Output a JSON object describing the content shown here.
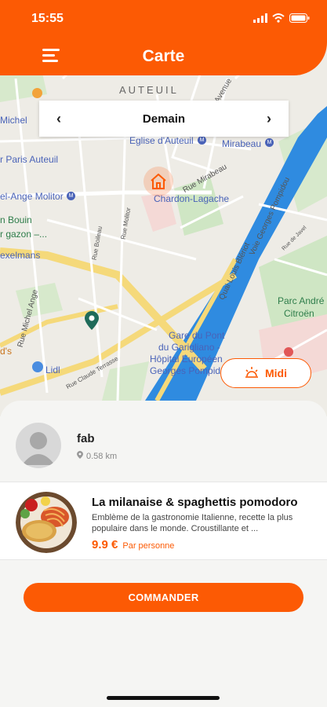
{
  "status": {
    "time": "15:55"
  },
  "header": {
    "title": "Carte"
  },
  "day_selector": {
    "prev": "‹",
    "day": "Demain",
    "next": "›"
  },
  "map": {
    "labels": {
      "auteuil": "AUTEUIL",
      "michel": "Michel",
      "paris_auteuil": "r Paris Auteuil",
      "eglise_auteuil": "Église d'Auteuil",
      "mirabeau": "Mirabeau",
      "michel_ange_molitor": "el-Ange Molitor",
      "chardon_lagache": "Chardon-Lagache",
      "bouin": "n Bouin",
      "gazon": "r gazon –...",
      "exelmans": "exelmans",
      "rue_mirabeau": "Rue Mirabeau",
      "rue_michel_ange": "Rue Michel Ange",
      "rue_boileau": "Rue Boileau",
      "rue_molitor": "Rue Molitor",
      "quai_louis_bleriot": "Quai Louis Blériot",
      "voie_georges_pompidou": "Voie Georges Pompidou",
      "parc_andre_citroen_1": "Parc André",
      "parc_andre_citroen_2": "Citroën",
      "gare_pont_garigliano_1": "Gare du Pont",
      "gare_pont_garigliano_2": "du Garigliano -",
      "hopital_1": "Hôpital Européen",
      "hopital_2": "Georges Pompidou",
      "lidl": "Lidl",
      "ds": "d's",
      "claude_terrasse": "Rue Claude Terrasse",
      "avenue": "Avenue",
      "rue_javel": "Rue de Javel"
    }
  },
  "midi_button": {
    "label": "Midi"
  },
  "cook": {
    "name": "fab",
    "distance": "0.58 km"
  },
  "dish": {
    "title": "La milanaise & spaghettis pomodoro",
    "description": "Emblème de la gastronomie Italienne, recette la plus populaire dans le monde. Croustillante et ...",
    "price": "9.9 €",
    "unit": "Par personne"
  },
  "order_button": {
    "label": "COMMANDER"
  },
  "colors": {
    "accent": "#fc5a04",
    "river": "#2f8be0",
    "park": "#cfe6c4"
  }
}
